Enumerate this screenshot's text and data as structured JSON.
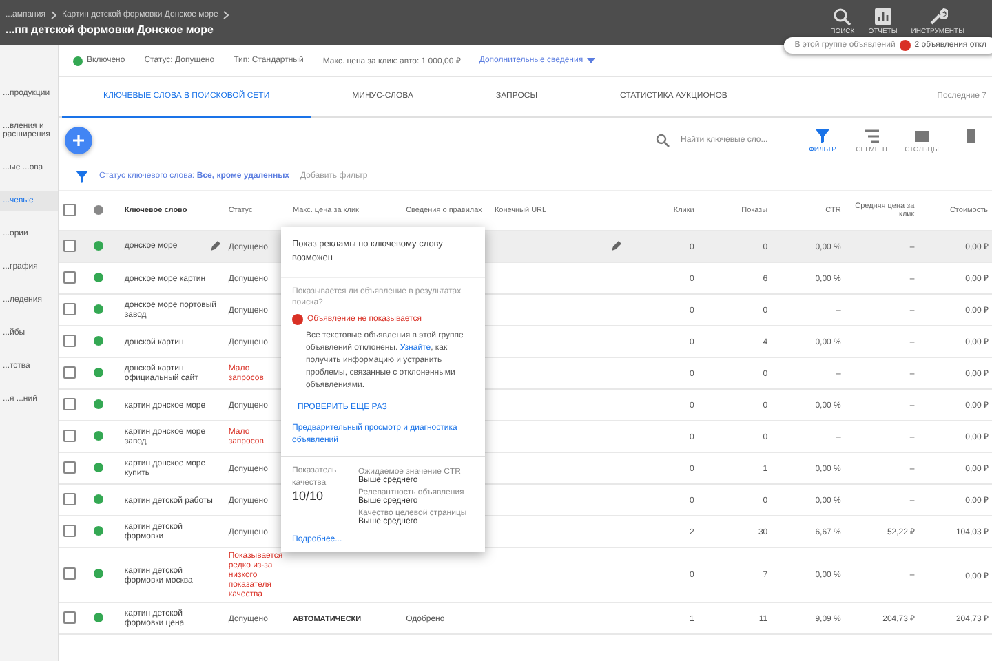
{
  "header": {
    "breadcrumb": [
      "...ампания",
      "Картин детской формовки Донское море"
    ],
    "title": "...пп детской формовки Донское море",
    "actions": [
      {
        "kind": "search",
        "label": "ПОИСК"
      },
      {
        "kind": "report",
        "label": "ОТЧЕТЫ"
      },
      {
        "kind": "tools",
        "label": "ИНСТРУМЕНТЫ"
      }
    ],
    "notice": {
      "text": "В этой группе объявлений",
      "alert": "2 объявления откл"
    }
  },
  "sidebar": {
    "items": [
      {
        "label": "...продукции",
        "selected": false
      },
      {
        "label": "...вления и расширения",
        "selected": false
      },
      {
        "label": "...ые ...ова",
        "selected": false
      },
      {
        "label": "...чевые",
        "selected": true
      },
      {
        "label": "...ории",
        "selected": false
      },
      {
        "label": "...графия",
        "selected": false
      },
      {
        "label": "...ледения",
        "selected": false
      },
      {
        "label": "...йбы",
        "selected": false
      },
      {
        "label": "...тства",
        "selected": false
      },
      {
        "label": "...я ...ний",
        "selected": false
      }
    ]
  },
  "status_bar": {
    "state": "Включено",
    "status": "Статус: Допущено",
    "type": "Тип: Стандартный",
    "bid": "Макс. цена за клик: авто: 1 000,00 ₽",
    "more": "Дополнительные сведения"
  },
  "tabs": [
    {
      "label": "КЛЮЧЕВЫЕ СЛОВА В ПОИСКОВОЙ СЕТИ",
      "selected": true
    },
    {
      "label": "МИНУС-СЛОВА",
      "selected": false
    },
    {
      "label": "ЗАПРОСЫ",
      "selected": false
    },
    {
      "label": "СТАТИСТИКА АУКЦИОНОВ",
      "selected": false
    }
  ],
  "date_range": "Последние 7",
  "toolbar": {
    "search_placeholder": "Найти ключевые сло...",
    "tools": [
      {
        "kind": "filter",
        "label": "ФИЛЬТР",
        "selected": true
      },
      {
        "kind": "segment",
        "label": "СЕГМЕНТ",
        "selected": false
      },
      {
        "kind": "columns",
        "label": "СТОЛБЦЫ",
        "selected": false
      },
      {
        "kind": "more",
        "label": "...",
        "selected": false
      }
    ]
  },
  "filter": {
    "label": "Статус ключевого слова:",
    "value": "Все, кроме удаленных",
    "add": "Добавить фильтр"
  },
  "table": {
    "header_checked": false,
    "columns": [
      "Ключевое слово",
      "Статус",
      "Макс. цена за клик",
      "Сведения о правилах",
      "Конечный URL",
      "Клики",
      "Показы",
      "CTR",
      "Средняя цена за клик",
      "Стоимость"
    ],
    "rows": [
      {
        "keyword": "донское море",
        "checked": false,
        "status": "Допущено",
        "warn": false,
        "max_cpc": "",
        "policy": "",
        "selected": true,
        "clicks": "0",
        "impr": "0",
        "ctr": "0,00 %",
        "cpc": "–",
        "cost": "0,00 ₽"
      },
      {
        "keyword": "донское море картин",
        "checked": false,
        "status": "Допущено",
        "warn": false,
        "max_cpc": "",
        "policy": "",
        "selected": false,
        "clicks": "0",
        "impr": "6",
        "ctr": "0,00 %",
        "cpc": "–",
        "cost": "0,00 ₽"
      },
      {
        "keyword": "донское море портовый завод",
        "checked": false,
        "status": "Допущено",
        "warn": false,
        "max_cpc": "",
        "policy": "",
        "selected": false,
        "clicks": "0",
        "impr": "0",
        "ctr": "–",
        "cpc": "–",
        "cost": "0,00 ₽"
      },
      {
        "keyword": "донской картин",
        "checked": false,
        "status": "Допущено",
        "warn": false,
        "max_cpc": "",
        "policy": "",
        "selected": false,
        "clicks": "0",
        "impr": "4",
        "ctr": "0,00 %",
        "cpc": "–",
        "cost": "0,00 ₽"
      },
      {
        "keyword": "донской картин официальный сайт",
        "checked": false,
        "status": "Мало запросов",
        "warn": true,
        "max_cpc": "",
        "policy": "",
        "selected": false,
        "clicks": "0",
        "impr": "0",
        "ctr": "–",
        "cpc": "–",
        "cost": "0,00 ₽"
      },
      {
        "keyword": "картин донское море",
        "checked": false,
        "status": "Допущено",
        "warn": false,
        "max_cpc": "",
        "policy": "",
        "selected": false,
        "clicks": "0",
        "impr": "0",
        "ctr": "0,00 %",
        "cpc": "–",
        "cost": "0,00 ₽"
      },
      {
        "keyword": "картин донское море завод",
        "checked": false,
        "status": "Мало запросов",
        "warn": true,
        "max_cpc": "",
        "policy": "",
        "selected": false,
        "clicks": "0",
        "impr": "0",
        "ctr": "–",
        "cpc": "–",
        "cost": "0,00 ₽"
      },
      {
        "keyword": "картин донское море купить",
        "checked": false,
        "status": "Допущено",
        "warn": false,
        "max_cpc": "",
        "policy": "",
        "selected": false,
        "clicks": "0",
        "impr": "1",
        "ctr": "0,00 %",
        "cpc": "–",
        "cost": "0,00 ₽"
      },
      {
        "keyword": "картин детской работы",
        "checked": false,
        "status": "Допущено",
        "warn": false,
        "max_cpc": "",
        "policy": "",
        "selected": false,
        "clicks": "0",
        "impr": "0",
        "ctr": "0,00 %",
        "cpc": "–",
        "cost": "0,00 ₽"
      },
      {
        "keyword": "картин детской формовки",
        "checked": false,
        "status": "Допущено",
        "warn": false,
        "max_cpc": "",
        "policy": "",
        "selected": false,
        "clicks": "2",
        "impr": "30",
        "ctr": "6,67 %",
        "cpc": "52,22 ₽",
        "cost": "104,03 ₽"
      },
      {
        "keyword": "картин детской формовки москва",
        "checked": false,
        "status": "Показывается редко из-за низкого показателя качества",
        "warn": true,
        "max_cpc": "",
        "policy": "",
        "selected": false,
        "clicks": "0",
        "impr": "7",
        "ctr": "0,00 %",
        "cpc": "–",
        "cost": "0,00 ₽"
      },
      {
        "keyword": "картин детской формовки цена",
        "checked": false,
        "status": "Допущено",
        "warn": false,
        "max_cpc": "АВТОМАТИЧЕСКИ",
        "policy": "Одобрено",
        "selected": false,
        "clicks": "1",
        "impr": "11",
        "ctr": "9,09 %",
        "cpc": "204,73 ₽",
        "cost": "204,73 ₽"
      }
    ]
  },
  "popup": {
    "title": "Показ рекламы по ключевому слову возможен",
    "question": "Показывается ли объявление в результатах поиска?",
    "alert": "Объявление не показывается",
    "detail": "Все текстовые объявления в этой группе объявлений отклонены.",
    "link_word": "Узнайте",
    "detail_after": ", как получить информацию и устранить проблемы, связанные с отклоненными объявлениями.",
    "recheck": "ПРОВЕРИТЬ ЕЩЕ РАЗ",
    "preview": "Предварительный просмотр и диагностика объявлений",
    "qs_label": "Показатель качества",
    "qs_value": "10/10",
    "factors": [
      {
        "name": "Ожидаемое значение CTR",
        "value": "Выше среднего"
      },
      {
        "name": "Релевантность объявления",
        "value": "Выше среднего"
      },
      {
        "name": "Качество целевой страницы",
        "value": "Выше среднего"
      }
    ],
    "more": "Подробнее..."
  }
}
